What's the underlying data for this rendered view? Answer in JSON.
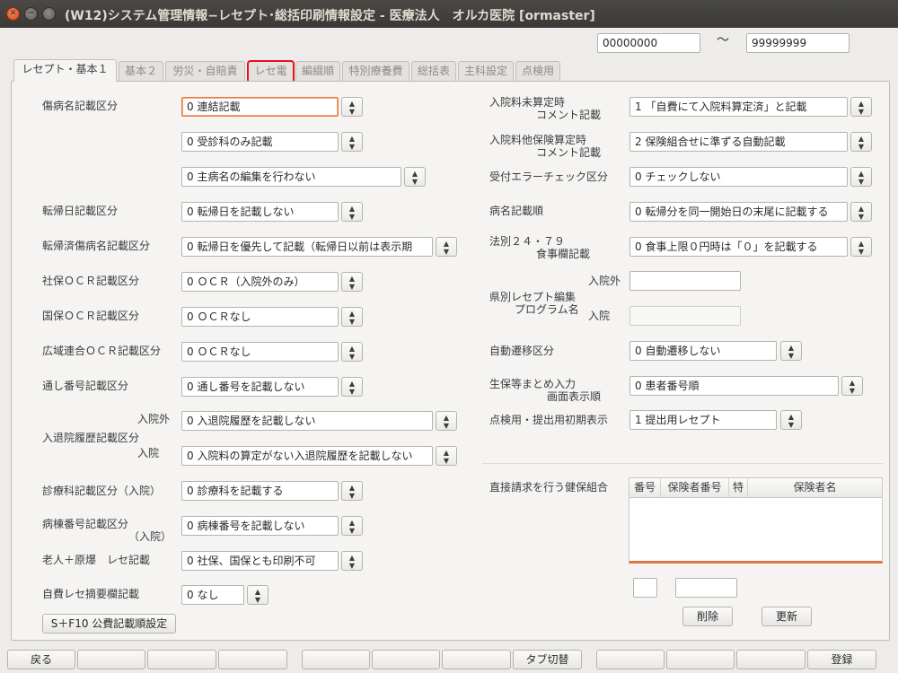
{
  "window": {
    "title": "(W12)システム管理情報−レセプト･総括印刷情報設定 - 医療法人　オルカ医院 [ormaster]"
  },
  "range": {
    "from": "00000000",
    "tilde": "〜",
    "to": "99999999"
  },
  "tabs": [
    "レセプト・基本１",
    "基本２",
    "労災・自賠責",
    "レセ電",
    "編綴順",
    "特別療養費",
    "総括表",
    "主科設定",
    "点検用"
  ],
  "left": {
    "byomei_label": "傷病名記載区分",
    "byomei1": "0 連結記載",
    "byomei2": "0 受診科のみ記載",
    "byomei3": "0 主病名の編集を行わない",
    "tenki_label": "転帰日記載区分",
    "tenki": "0 転帰日を記載しない",
    "tenkizumi_label": "転帰済傷病名記載区分",
    "tenkizumi": "0 転帰日を優先して記載（転帰日以前は表示期",
    "shaho_label": "社保ＯＣＲ記載区分",
    "shaho": "0 ＯＣＲ（入院外のみ）",
    "kokuho_label": "国保ＯＣＲ記載区分",
    "kokuho": "0 ＯＣＲなし",
    "koiki_label": "広域連合ＯＣＲ記載区分",
    "koiki": "0 ＯＣＲなし",
    "toshi_label": "通し番号記載区分",
    "toshi": "0 通し番号を記載しない",
    "nyutai_label": "入退院履歴記載区分",
    "nyutai_gai_label": "入院外",
    "nyutai_gai": "0 入退院履歴を記載しない",
    "nyutai_in_label": "入院",
    "nyutai_in": "0 入院料の算定がない入退院履歴を記載しない",
    "shinryoka_label": "診療科記載区分（入院）",
    "shinryoka": "0 診療科を記載する",
    "byoto_label": "病棟番号記載区分",
    "byoto_label2": "（入院）",
    "byoto": "0 病棟番号を記載しない",
    "rojin_label": "老人＋原爆　レセ記載",
    "rojin": "0 社保、国保とも印刷不可",
    "jihi_label": "自費レセ摘要欄記載",
    "jihi": "0 なし",
    "kohi_button": "S＋F10 公費記載順設定"
  },
  "right": {
    "nyuinryo_label1": "入院料未算定時",
    "nyuinryo_label2": "コメント記載",
    "nyuinryo": "1 「自費にて入院料算定済」と記載",
    "tahoken_label1": "入院料他保険算定時",
    "tahoken_label2": "コメント記載",
    "tahoken": "2 保険組合せに準ずる自動記載",
    "uketsuke_label": "受付エラーチェック区分",
    "uketsuke": "0 チェックしない",
    "byomeijun_label": "病名記載順",
    "byomeijun": "0 転帰分を同一開始日の末尾に記載する",
    "hobetsu_label1": "法別２４・７９",
    "hobetsu_label2": "食事欄記載",
    "hobetsu": "0 食事上限０円時は「０」を記載する",
    "kenbetsu_label1": "県別レセプト編集",
    "kenbetsu_label2": "プログラム名",
    "kenbetsu_gai_label": "入院外",
    "kenbetsu_in_label": "入院",
    "jido_label": "自動遷移区分",
    "jido": "0 自動遷移しない",
    "seiho_label1": "生保等まとめ入力",
    "seiho_label2": "画面表示順",
    "seiho": "0 患者番号順",
    "tenken_label": "点検用・提出用初期表示",
    "tenken": "1 提出用レセプト",
    "chokusetsu_label": "直接請求を行う健保組合",
    "table_headers": [
      "番号",
      "保険者番号",
      "特",
      "保険者名"
    ],
    "delete_button": "削除",
    "update_button": "更新"
  },
  "fkeys": [
    "戻る",
    "",
    "",
    "",
    "",
    "",
    "",
    "タブ切替",
    "",
    "",
    "",
    "登録"
  ]
}
